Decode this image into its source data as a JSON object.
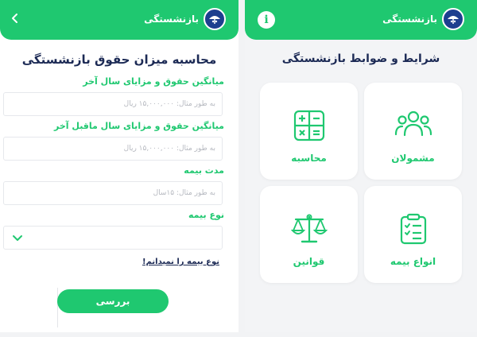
{
  "brand": {
    "name": "بازنشستگی",
    "logo_icon": "umbrella-logo-icon"
  },
  "colors": {
    "accent": "#1fc870",
    "title": "#1c2a55",
    "placeholder": "#b6b9c0"
  },
  "left": {
    "title": "محاسبه میزان حقوق بازنشستگی",
    "back_icon": "chevron-left-icon",
    "fields": [
      {
        "label": "میانگین حقوق و مزایای سال آخر",
        "placeholder": "به طور مثال: ۱۵,۰۰۰,۰۰۰ ریال"
      },
      {
        "label": "میانگین حقوق و مزایای سال ماقبل آخر",
        "placeholder": "به طور مثال: ۱۵,۰۰۰,۰۰۰ ریال"
      },
      {
        "label": "مدت بیمه",
        "placeholder": "به طور مثال: ۱۵سال"
      }
    ],
    "insurance_type": {
      "label": "نوع بیمه",
      "value": ""
    },
    "help_link": "نوع بیمه را نمیدانم!",
    "submit_label": "بررسی"
  },
  "right": {
    "title": "شرایط و ضوابط بازنشستگی",
    "info_label": "i",
    "cards": [
      {
        "label": "مشمولان",
        "icon": "users-icon"
      },
      {
        "label": "محاسبه",
        "icon": "calculator-icon"
      },
      {
        "label": "انواع بیمه",
        "icon": "clipboard-icon"
      },
      {
        "label": "قوانین",
        "icon": "scales-icon"
      }
    ]
  }
}
